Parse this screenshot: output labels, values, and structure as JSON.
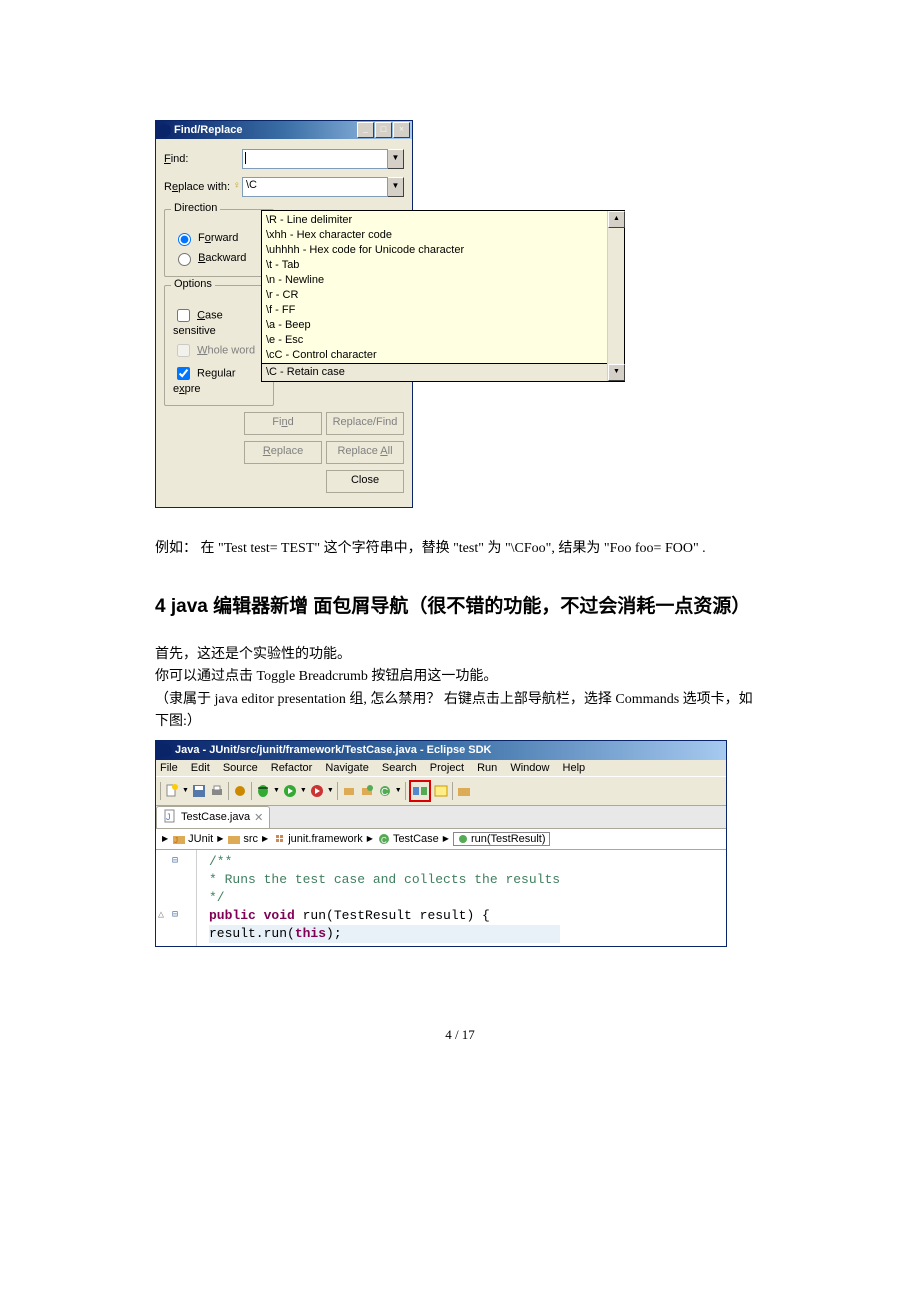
{
  "findReplace": {
    "title": "Find/Replace",
    "findLabel": "Find:",
    "replaceLabel": "Replace with:",
    "replaceValue": "\\C",
    "direction": {
      "title": "Direction",
      "forward": "Forward",
      "backward": "Backward"
    },
    "options": {
      "title": "Options",
      "caseSensitive": "Case sensitive",
      "wholeWord": "Whole word",
      "regex": "Regular expre"
    },
    "buttons": {
      "find": "Find",
      "replaceFind": "Replace/Find",
      "replace": "Replace",
      "replaceAll": "Replace All",
      "close": "Close"
    }
  },
  "tooltip": {
    "items": [
      "\\R - Line delimiter",
      "\\xhh - Hex character code",
      "\\uhhhh - Hex code for Unicode character",
      "\\t - Tab",
      "\\n - Newline",
      "\\r - CR",
      "\\f - FF",
      "\\a - Beep",
      "\\e - Esc",
      "\\cC - Control character",
      "\\C - Retain case"
    ]
  },
  "text1": "例如：  在  \"Test test= TEST\"  这个字符串中，替换  \"test\"  为  \"\\CFoo\",  结果为  \"Foo foo= FOO\" .",
  "heading": "4 java 编辑器新增  面包屑导航（很不错的功能，不过会消耗一点资源）",
  "para1": "首先，这还是个实验性的功能。",
  "para2": "你可以通过点击  Toggle Breadcrumb  按钮启用这一功能。",
  "para3": "（隶属于  java editor presentation  组,  怎么禁用？  右键点击上部导航栏，选择  Commands 选项卡，如下图:）",
  "eclipse": {
    "title": "Java - JUnit/src/junit/framework/TestCase.java - Eclipse SDK",
    "menus": [
      "File",
      "Edit",
      "Source",
      "Refactor",
      "Navigate",
      "Search",
      "Project",
      "Run",
      "Window",
      "Help"
    ],
    "tab": "TestCase.java",
    "breadcrumb": [
      "JUnit",
      "src",
      "junit.framework",
      "TestCase",
      "run(TestResult)"
    ],
    "code": {
      "c1": "/**",
      "c2": " * Runs the test case and collects the results",
      "c3": " */",
      "l4a": "public",
      "l4b": " void",
      "l4c": " run(TestResult result) {",
      "l5a": "    result.run(",
      "l5b": "this",
      "l5c": ");"
    }
  },
  "pageNum": "4  /  17"
}
